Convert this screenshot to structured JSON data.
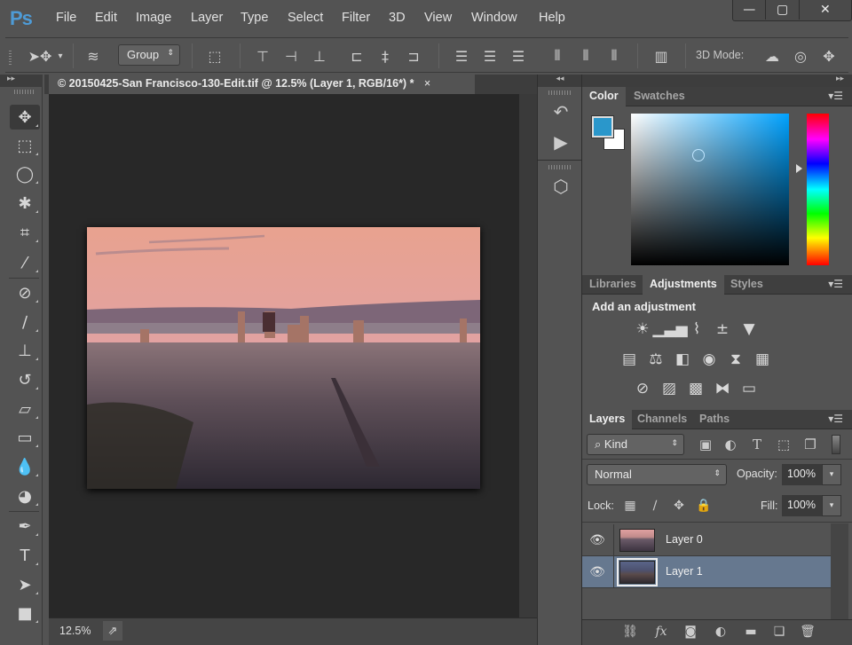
{
  "app": {
    "logo": "Ps"
  },
  "menu": [
    "File",
    "Edit",
    "Image",
    "Layer",
    "Type",
    "Select",
    "Filter",
    "3D",
    "View",
    "Window",
    "Help"
  ],
  "window_controls": {
    "minimize": "—",
    "maximize": "▢",
    "close": "✕"
  },
  "options_bar": {
    "move_tool_icon": "move-tool-icon",
    "auto_select_target": "Group",
    "mode_label": "3D Mode:"
  },
  "document": {
    "tab_title": "© 20150425-San Francisco-130-Edit.tif @ 12.5% (Layer 1, RGB/16*) *",
    "close": "×",
    "zoom_level": "12.5%"
  },
  "tools": [
    {
      "name": "move-tool",
      "glyph": "✥"
    },
    {
      "name": "marquee-tool",
      "glyph": "⬚"
    },
    {
      "name": "lasso-tool",
      "glyph": "◯"
    },
    {
      "name": "magic-wand-tool",
      "glyph": "✱"
    },
    {
      "name": "crop-tool",
      "glyph": "⌗"
    },
    {
      "name": "eyedropper-tool",
      "glyph": "⁄"
    },
    {
      "name": "healing-brush-tool",
      "glyph": "⊘"
    },
    {
      "name": "brush-tool",
      "glyph": "∕"
    },
    {
      "name": "clone-stamp-tool",
      "glyph": "⊥"
    },
    {
      "name": "history-brush-tool",
      "glyph": "↺"
    },
    {
      "name": "eraser-tool",
      "glyph": "▱"
    },
    {
      "name": "gradient-tool",
      "glyph": "▭"
    },
    {
      "name": "blur-tool",
      "glyph": "💧"
    },
    {
      "name": "dodge-tool",
      "glyph": "◕"
    },
    {
      "name": "pen-tool",
      "glyph": "✒"
    },
    {
      "name": "type-tool",
      "glyph": "T"
    },
    {
      "name": "path-selection-tool",
      "glyph": "➤"
    },
    {
      "name": "rectangle-tool",
      "glyph": "■"
    }
  ],
  "color_panel": {
    "tabs": [
      "Color",
      "Swatches"
    ],
    "foreground": "#2a97cb",
    "background": "#ffffff"
  },
  "adjustments_panel": {
    "tabs": [
      "Libraries",
      "Adjustments",
      "Styles"
    ],
    "title": "Add an adjustment",
    "icons": [
      [
        "brightness-contrast-icon",
        "levels-icon",
        "curves-icon",
        "exposure-icon",
        "vibrance-icon"
      ],
      [
        "hue-saturation-icon",
        "color-balance-icon",
        "black-white-icon",
        "photo-filter-icon",
        "channel-mixer-icon",
        "color-lookup-icon"
      ],
      [
        "invert-icon",
        "posterize-icon",
        "threshold-icon",
        "selective-color-icon",
        "gradient-map-icon"
      ]
    ]
  },
  "layers_panel": {
    "tabs": [
      "Layers",
      "Channels",
      "Paths"
    ],
    "filter_kind": "Kind",
    "blend_mode": "Normal",
    "opacity_label": "Opacity:",
    "opacity": "100%",
    "lock_label": "Lock:",
    "fill_label": "Fill:",
    "fill": "100%",
    "layers": [
      {
        "name": "Layer 0",
        "visible": true,
        "selected": false
      },
      {
        "name": "Layer 1",
        "visible": true,
        "selected": true
      }
    ]
  }
}
